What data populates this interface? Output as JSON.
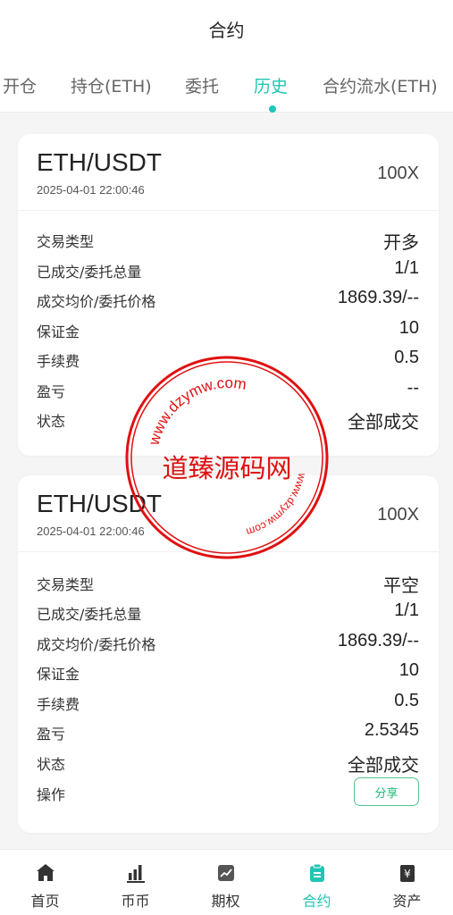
{
  "header": {
    "title": "合约"
  },
  "tabs": [
    {
      "label": "开仓"
    },
    {
      "label": "持仓(ETH)"
    },
    {
      "label": "委托"
    },
    {
      "label": "历史"
    },
    {
      "label": "合约流水(ETH)"
    }
  ],
  "active_tab": "历史",
  "accent_color": "#20c5b4",
  "cards": [
    {
      "pair": "ETH/USDT",
      "time": "2025-04-01 22:00:46",
      "leverage": "100X",
      "rows": [
        {
          "label": "交易类型",
          "value": "开多"
        },
        {
          "label": "已成交/委托总量",
          "value": "1/1"
        },
        {
          "label": "成交均价/委托价格",
          "value": "1869.39/--"
        },
        {
          "label": "保证金",
          "value": "10"
        },
        {
          "label": "手续费",
          "value": "0.5"
        },
        {
          "label": "盈亏",
          "value": "--"
        },
        {
          "label": "状态",
          "value": "全部成交"
        }
      ]
    },
    {
      "pair": "ETH/USDT",
      "time": "2025-04-01 22:00:46",
      "leverage": "100X",
      "rows": [
        {
          "label": "交易类型",
          "value": "平空"
        },
        {
          "label": "已成交/委托总量",
          "value": "1/1"
        },
        {
          "label": "成交均价/委托价格",
          "value": "1869.39/--"
        },
        {
          "label": "保证金",
          "value": "10"
        },
        {
          "label": "手续费",
          "value": "0.5"
        },
        {
          "label": "盈亏",
          "value": "2.5345"
        },
        {
          "label": "状态",
          "value": "全部成交"
        }
      ],
      "action_label": "操作",
      "share_label": "分享"
    }
  ],
  "watermark": {
    "center_text": "道臻源码网",
    "ring_text": "www.dzymw.com",
    "color": "#e01010"
  },
  "bottom_nav": [
    {
      "label": "首页",
      "icon": "home-icon"
    },
    {
      "label": "币币",
      "icon": "bar-chart-icon"
    },
    {
      "label": "期权",
      "icon": "options-chart-icon"
    },
    {
      "label": "合约",
      "icon": "contract-clipboard-icon",
      "active": true
    },
    {
      "label": "资产",
      "icon": "wallet-yen-icon"
    }
  ]
}
